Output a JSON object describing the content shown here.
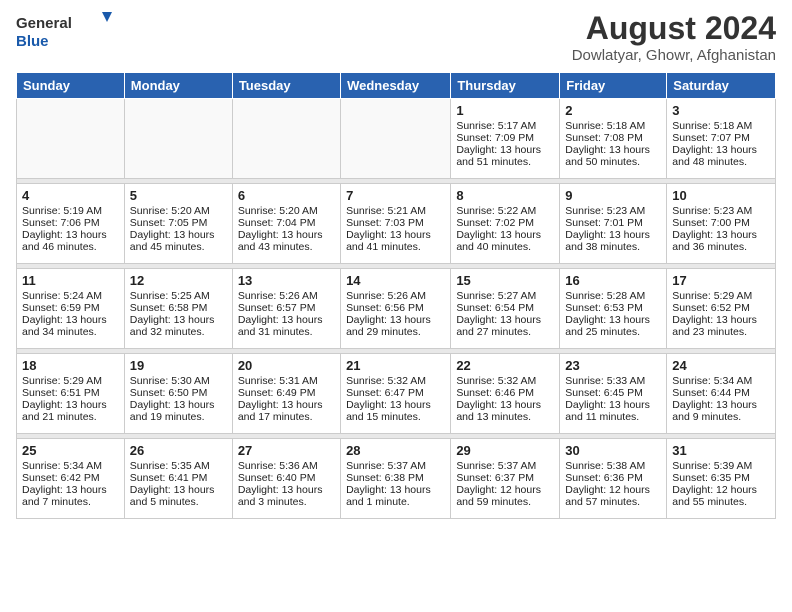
{
  "logo": {
    "general": "General",
    "blue": "Blue"
  },
  "title": "August 2024",
  "subtitle": "Dowlatyar, Ghowr, Afghanistan",
  "weekdays": [
    "Sunday",
    "Monday",
    "Tuesday",
    "Wednesday",
    "Thursday",
    "Friday",
    "Saturday"
  ],
  "weeks": [
    [
      {
        "day": "",
        "info": ""
      },
      {
        "day": "",
        "info": ""
      },
      {
        "day": "",
        "info": ""
      },
      {
        "day": "",
        "info": ""
      },
      {
        "day": "1",
        "info": "Sunrise: 5:17 AM\nSunset: 7:09 PM\nDaylight: 13 hours\nand 51 minutes."
      },
      {
        "day": "2",
        "info": "Sunrise: 5:18 AM\nSunset: 7:08 PM\nDaylight: 13 hours\nand 50 minutes."
      },
      {
        "day": "3",
        "info": "Sunrise: 5:18 AM\nSunset: 7:07 PM\nDaylight: 13 hours\nand 48 minutes."
      }
    ],
    [
      {
        "day": "4",
        "info": "Sunrise: 5:19 AM\nSunset: 7:06 PM\nDaylight: 13 hours\nand 46 minutes."
      },
      {
        "day": "5",
        "info": "Sunrise: 5:20 AM\nSunset: 7:05 PM\nDaylight: 13 hours\nand 45 minutes."
      },
      {
        "day": "6",
        "info": "Sunrise: 5:20 AM\nSunset: 7:04 PM\nDaylight: 13 hours\nand 43 minutes."
      },
      {
        "day": "7",
        "info": "Sunrise: 5:21 AM\nSunset: 7:03 PM\nDaylight: 13 hours\nand 41 minutes."
      },
      {
        "day": "8",
        "info": "Sunrise: 5:22 AM\nSunset: 7:02 PM\nDaylight: 13 hours\nand 40 minutes."
      },
      {
        "day": "9",
        "info": "Sunrise: 5:23 AM\nSunset: 7:01 PM\nDaylight: 13 hours\nand 38 minutes."
      },
      {
        "day": "10",
        "info": "Sunrise: 5:23 AM\nSunset: 7:00 PM\nDaylight: 13 hours\nand 36 minutes."
      }
    ],
    [
      {
        "day": "11",
        "info": "Sunrise: 5:24 AM\nSunset: 6:59 PM\nDaylight: 13 hours\nand 34 minutes."
      },
      {
        "day": "12",
        "info": "Sunrise: 5:25 AM\nSunset: 6:58 PM\nDaylight: 13 hours\nand 32 minutes."
      },
      {
        "day": "13",
        "info": "Sunrise: 5:26 AM\nSunset: 6:57 PM\nDaylight: 13 hours\nand 31 minutes."
      },
      {
        "day": "14",
        "info": "Sunrise: 5:26 AM\nSunset: 6:56 PM\nDaylight: 13 hours\nand 29 minutes."
      },
      {
        "day": "15",
        "info": "Sunrise: 5:27 AM\nSunset: 6:54 PM\nDaylight: 13 hours\nand 27 minutes."
      },
      {
        "day": "16",
        "info": "Sunrise: 5:28 AM\nSunset: 6:53 PM\nDaylight: 13 hours\nand 25 minutes."
      },
      {
        "day": "17",
        "info": "Sunrise: 5:29 AM\nSunset: 6:52 PM\nDaylight: 13 hours\nand 23 minutes."
      }
    ],
    [
      {
        "day": "18",
        "info": "Sunrise: 5:29 AM\nSunset: 6:51 PM\nDaylight: 13 hours\nand 21 minutes."
      },
      {
        "day": "19",
        "info": "Sunrise: 5:30 AM\nSunset: 6:50 PM\nDaylight: 13 hours\nand 19 minutes."
      },
      {
        "day": "20",
        "info": "Sunrise: 5:31 AM\nSunset: 6:49 PM\nDaylight: 13 hours\nand 17 minutes."
      },
      {
        "day": "21",
        "info": "Sunrise: 5:32 AM\nSunset: 6:47 PM\nDaylight: 13 hours\nand 15 minutes."
      },
      {
        "day": "22",
        "info": "Sunrise: 5:32 AM\nSunset: 6:46 PM\nDaylight: 13 hours\nand 13 minutes."
      },
      {
        "day": "23",
        "info": "Sunrise: 5:33 AM\nSunset: 6:45 PM\nDaylight: 13 hours\nand 11 minutes."
      },
      {
        "day": "24",
        "info": "Sunrise: 5:34 AM\nSunset: 6:44 PM\nDaylight: 13 hours\nand 9 minutes."
      }
    ],
    [
      {
        "day": "25",
        "info": "Sunrise: 5:34 AM\nSunset: 6:42 PM\nDaylight: 13 hours\nand 7 minutes."
      },
      {
        "day": "26",
        "info": "Sunrise: 5:35 AM\nSunset: 6:41 PM\nDaylight: 13 hours\nand 5 minutes."
      },
      {
        "day": "27",
        "info": "Sunrise: 5:36 AM\nSunset: 6:40 PM\nDaylight: 13 hours\nand 3 minutes."
      },
      {
        "day": "28",
        "info": "Sunrise: 5:37 AM\nSunset: 6:38 PM\nDaylight: 13 hours\nand 1 minute."
      },
      {
        "day": "29",
        "info": "Sunrise: 5:37 AM\nSunset: 6:37 PM\nDaylight: 12 hours\nand 59 minutes."
      },
      {
        "day": "30",
        "info": "Sunrise: 5:38 AM\nSunset: 6:36 PM\nDaylight: 12 hours\nand 57 minutes."
      },
      {
        "day": "31",
        "info": "Sunrise: 5:39 AM\nSunset: 6:35 PM\nDaylight: 12 hours\nand 55 minutes."
      }
    ]
  ]
}
